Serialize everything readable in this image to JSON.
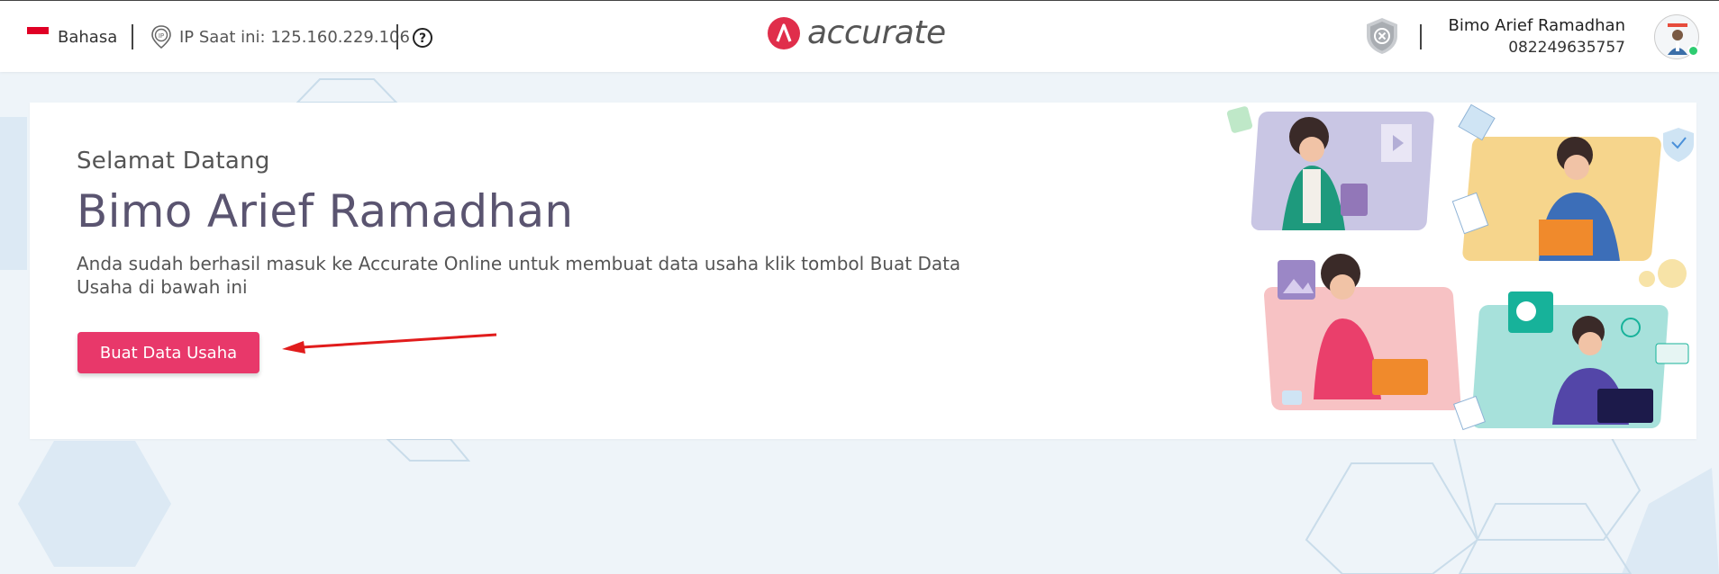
{
  "header": {
    "language_label": "Bahasa",
    "ip_label": "IP Saat ini: 125.160.229.106",
    "logo_text": "accurate",
    "user_name": "Bimo Arief Ramadhan",
    "user_phone": "082249635757"
  },
  "welcome": {
    "greeting": "Selamat Datang",
    "name": "Bimo Arief Ramadhan",
    "description": "Anda sudah berhasil masuk ke Accurate Online untuk membuat data usaha klik tombol Buat Data Usaha di bawah ini",
    "create_button_label": "Buat Data Usaha"
  },
  "icons": {
    "language": "indonesia-flag-icon",
    "ip": "ip-icon",
    "help": "help-icon",
    "security": "shield-icon",
    "annotation": "red-arrow"
  },
  "colors": {
    "brand": "#e8386a",
    "title": "#5a5470",
    "online": "#2ecc71"
  }
}
